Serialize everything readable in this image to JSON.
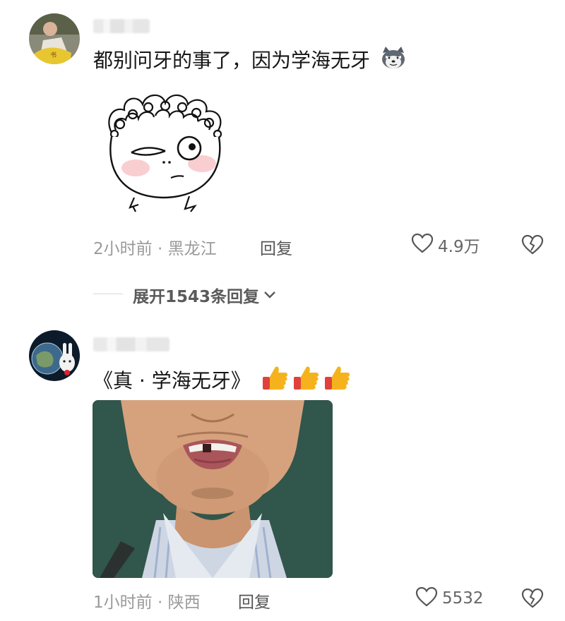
{
  "comments": [
    {
      "text": "都别问牙的事了，因为学海无牙",
      "meta": "2小时前 · 黑龙江",
      "reply_label": "回复",
      "like_count": "4.9万",
      "expand_label": "展开1543条回复"
    },
    {
      "text": "《真 · 学海无牙》",
      "meta": "1小时前 · 陕西",
      "reply_label": "回复",
      "like_count": "5532"
    }
  ],
  "icons": {
    "like": "heart-outline-icon",
    "dislike": "broken-heart-icon",
    "expand": "chevron-down-icon",
    "emoji_1": "husky-dog-emoji",
    "emoji_2": "thumbs-up-emoji"
  },
  "colors": {
    "text": "#161616",
    "meta": "#9a9a9a",
    "blush": "#f7c2c5"
  }
}
